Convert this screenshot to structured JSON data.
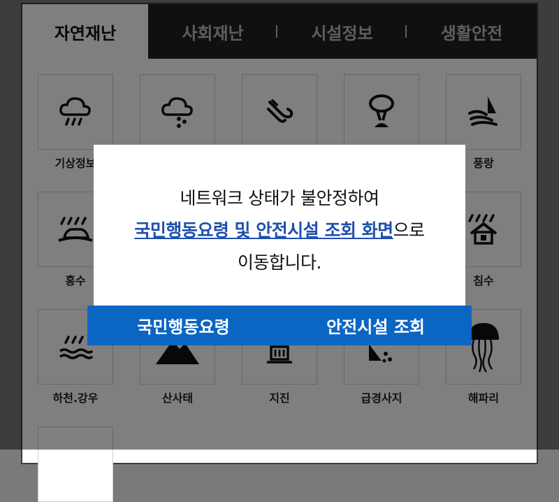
{
  "tabs": [
    {
      "label": "자연재난",
      "active": true
    },
    {
      "label": "사회재난"
    },
    {
      "label": "시설정보"
    },
    {
      "label": "생활안전"
    }
  ],
  "grid": {
    "items": [
      {
        "label": "기상정보",
        "icon": "rain-cloud-icon"
      },
      {
        "label": "",
        "icon": "hail-cloud-icon"
      },
      {
        "label": "",
        "icon": "wind-icon"
      },
      {
        "label": "",
        "icon": "tornado-icon"
      },
      {
        "label": "풍랑",
        "icon": "wind-wave-sailboat-icon"
      },
      {
        "label": "홍수",
        "icon": "flood-car-icon"
      },
      {
        "label": "",
        "icon": "blank"
      },
      {
        "label": "",
        "icon": "blank"
      },
      {
        "label": "",
        "icon": "blank"
      },
      {
        "label": "침수",
        "icon": "flooded-house-icon"
      },
      {
        "label": "하천.강우",
        "icon": "river-rain-icon"
      },
      {
        "label": "산사태",
        "icon": "landslide-icon"
      },
      {
        "label": "지진",
        "icon": "earthquake-building-icon"
      },
      {
        "label": "급경사지",
        "icon": "steep-slope-icon"
      },
      {
        "label": "해파리",
        "icon": "jellyfish-icon"
      },
      {
        "label": "",
        "icon": "blank"
      }
    ]
  },
  "dialog": {
    "line1": "네트워크 상태가 불안정하여",
    "link": "국민행동요령 및 안전시설 조회 화면",
    "line2_suffix": "으로",
    "line3": "이동합니다.",
    "buttons": {
      "left": "국민행동요령",
      "right": "안전시설 조회"
    }
  },
  "colors": {
    "tab_bar": "#202020",
    "button_bar": "#0b66c3",
    "link": "#1f4fae"
  }
}
